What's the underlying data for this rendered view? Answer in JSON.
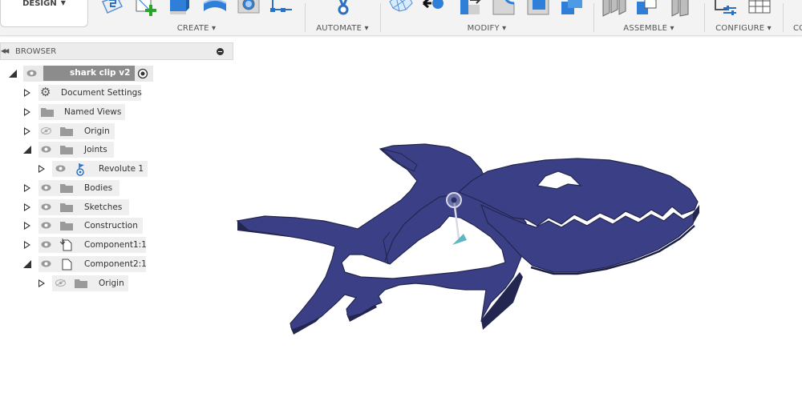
{
  "toolbar": {
    "workspace": "DESIGN",
    "groups": [
      {
        "label": "CREATE ▾"
      },
      {
        "label": "AUTOMATE ▾"
      },
      {
        "label": "MODIFY ▾"
      },
      {
        "label": "ASSEMBLE ▾"
      },
      {
        "label": "CONFIGURE ▾"
      },
      {
        "label": "CO"
      }
    ]
  },
  "browser": {
    "title": "BROWSER",
    "root": "shark clip v2",
    "items": [
      {
        "label": "Document Settings"
      },
      {
        "label": "Named Views"
      },
      {
        "label": "Origin"
      },
      {
        "label": "Joints"
      },
      {
        "label": "Revolute 1"
      },
      {
        "label": "Bodies"
      },
      {
        "label": "Sketches"
      },
      {
        "label": "Construction"
      },
      {
        "label": "Component1:1"
      },
      {
        "label": "Component2:1"
      },
      {
        "label": "Origin"
      }
    ]
  },
  "colors": {
    "shark_fill": "#3b3f86",
    "shark_edge": "#23264f",
    "joint_teal": "#5fb6c2"
  }
}
